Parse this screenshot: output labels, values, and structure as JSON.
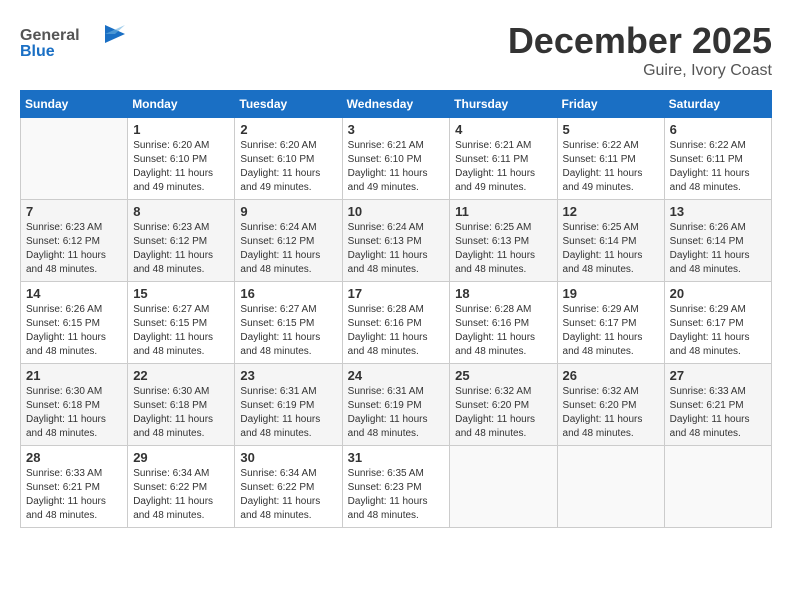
{
  "logo": {
    "text_general": "General",
    "text_blue": "Blue"
  },
  "title": {
    "month_year": "December 2025",
    "location": "Guire, Ivory Coast"
  },
  "weekdays": [
    "Sunday",
    "Monday",
    "Tuesday",
    "Wednesday",
    "Thursday",
    "Friday",
    "Saturday"
  ],
  "weeks": [
    [
      {
        "day": "",
        "sunrise": "",
        "sunset": "",
        "daylight": ""
      },
      {
        "day": "1",
        "sunrise": "Sunrise: 6:20 AM",
        "sunset": "Sunset: 6:10 PM",
        "daylight": "Daylight: 11 hours and 49 minutes."
      },
      {
        "day": "2",
        "sunrise": "Sunrise: 6:20 AM",
        "sunset": "Sunset: 6:10 PM",
        "daylight": "Daylight: 11 hours and 49 minutes."
      },
      {
        "day": "3",
        "sunrise": "Sunrise: 6:21 AM",
        "sunset": "Sunset: 6:10 PM",
        "daylight": "Daylight: 11 hours and 49 minutes."
      },
      {
        "day": "4",
        "sunrise": "Sunrise: 6:21 AM",
        "sunset": "Sunset: 6:11 PM",
        "daylight": "Daylight: 11 hours and 49 minutes."
      },
      {
        "day": "5",
        "sunrise": "Sunrise: 6:22 AM",
        "sunset": "Sunset: 6:11 PM",
        "daylight": "Daylight: 11 hours and 49 minutes."
      },
      {
        "day": "6",
        "sunrise": "Sunrise: 6:22 AM",
        "sunset": "Sunset: 6:11 PM",
        "daylight": "Daylight: 11 hours and 48 minutes."
      }
    ],
    [
      {
        "day": "7",
        "sunrise": "Sunrise: 6:23 AM",
        "sunset": "Sunset: 6:12 PM",
        "daylight": "Daylight: 11 hours and 48 minutes."
      },
      {
        "day": "8",
        "sunrise": "Sunrise: 6:23 AM",
        "sunset": "Sunset: 6:12 PM",
        "daylight": "Daylight: 11 hours and 48 minutes."
      },
      {
        "day": "9",
        "sunrise": "Sunrise: 6:24 AM",
        "sunset": "Sunset: 6:12 PM",
        "daylight": "Daylight: 11 hours and 48 minutes."
      },
      {
        "day": "10",
        "sunrise": "Sunrise: 6:24 AM",
        "sunset": "Sunset: 6:13 PM",
        "daylight": "Daylight: 11 hours and 48 minutes."
      },
      {
        "day": "11",
        "sunrise": "Sunrise: 6:25 AM",
        "sunset": "Sunset: 6:13 PM",
        "daylight": "Daylight: 11 hours and 48 minutes."
      },
      {
        "day": "12",
        "sunrise": "Sunrise: 6:25 AM",
        "sunset": "Sunset: 6:14 PM",
        "daylight": "Daylight: 11 hours and 48 minutes."
      },
      {
        "day": "13",
        "sunrise": "Sunrise: 6:26 AM",
        "sunset": "Sunset: 6:14 PM",
        "daylight": "Daylight: 11 hours and 48 minutes."
      }
    ],
    [
      {
        "day": "14",
        "sunrise": "Sunrise: 6:26 AM",
        "sunset": "Sunset: 6:15 PM",
        "daylight": "Daylight: 11 hours and 48 minutes."
      },
      {
        "day": "15",
        "sunrise": "Sunrise: 6:27 AM",
        "sunset": "Sunset: 6:15 PM",
        "daylight": "Daylight: 11 hours and 48 minutes."
      },
      {
        "day": "16",
        "sunrise": "Sunrise: 6:27 AM",
        "sunset": "Sunset: 6:15 PM",
        "daylight": "Daylight: 11 hours and 48 minutes."
      },
      {
        "day": "17",
        "sunrise": "Sunrise: 6:28 AM",
        "sunset": "Sunset: 6:16 PM",
        "daylight": "Daylight: 11 hours and 48 minutes."
      },
      {
        "day": "18",
        "sunrise": "Sunrise: 6:28 AM",
        "sunset": "Sunset: 6:16 PM",
        "daylight": "Daylight: 11 hours and 48 minutes."
      },
      {
        "day": "19",
        "sunrise": "Sunrise: 6:29 AM",
        "sunset": "Sunset: 6:17 PM",
        "daylight": "Daylight: 11 hours and 48 minutes."
      },
      {
        "day": "20",
        "sunrise": "Sunrise: 6:29 AM",
        "sunset": "Sunset: 6:17 PM",
        "daylight": "Daylight: 11 hours and 48 minutes."
      }
    ],
    [
      {
        "day": "21",
        "sunrise": "Sunrise: 6:30 AM",
        "sunset": "Sunset: 6:18 PM",
        "daylight": "Daylight: 11 hours and 48 minutes."
      },
      {
        "day": "22",
        "sunrise": "Sunrise: 6:30 AM",
        "sunset": "Sunset: 6:18 PM",
        "daylight": "Daylight: 11 hours and 48 minutes."
      },
      {
        "day": "23",
        "sunrise": "Sunrise: 6:31 AM",
        "sunset": "Sunset: 6:19 PM",
        "daylight": "Daylight: 11 hours and 48 minutes."
      },
      {
        "day": "24",
        "sunrise": "Sunrise: 6:31 AM",
        "sunset": "Sunset: 6:19 PM",
        "daylight": "Daylight: 11 hours and 48 minutes."
      },
      {
        "day": "25",
        "sunrise": "Sunrise: 6:32 AM",
        "sunset": "Sunset: 6:20 PM",
        "daylight": "Daylight: 11 hours and 48 minutes."
      },
      {
        "day": "26",
        "sunrise": "Sunrise: 6:32 AM",
        "sunset": "Sunset: 6:20 PM",
        "daylight": "Daylight: 11 hours and 48 minutes."
      },
      {
        "day": "27",
        "sunrise": "Sunrise: 6:33 AM",
        "sunset": "Sunset: 6:21 PM",
        "daylight": "Daylight: 11 hours and 48 minutes."
      }
    ],
    [
      {
        "day": "28",
        "sunrise": "Sunrise: 6:33 AM",
        "sunset": "Sunset: 6:21 PM",
        "daylight": "Daylight: 11 hours and 48 minutes."
      },
      {
        "day": "29",
        "sunrise": "Sunrise: 6:34 AM",
        "sunset": "Sunset: 6:22 PM",
        "daylight": "Daylight: 11 hours and 48 minutes."
      },
      {
        "day": "30",
        "sunrise": "Sunrise: 6:34 AM",
        "sunset": "Sunset: 6:22 PM",
        "daylight": "Daylight: 11 hours and 48 minutes."
      },
      {
        "day": "31",
        "sunrise": "Sunrise: 6:35 AM",
        "sunset": "Sunset: 6:23 PM",
        "daylight": "Daylight: 11 hours and 48 minutes."
      },
      {
        "day": "",
        "sunrise": "",
        "sunset": "",
        "daylight": ""
      },
      {
        "day": "",
        "sunrise": "",
        "sunset": "",
        "daylight": ""
      },
      {
        "day": "",
        "sunrise": "",
        "sunset": "",
        "daylight": ""
      }
    ]
  ]
}
